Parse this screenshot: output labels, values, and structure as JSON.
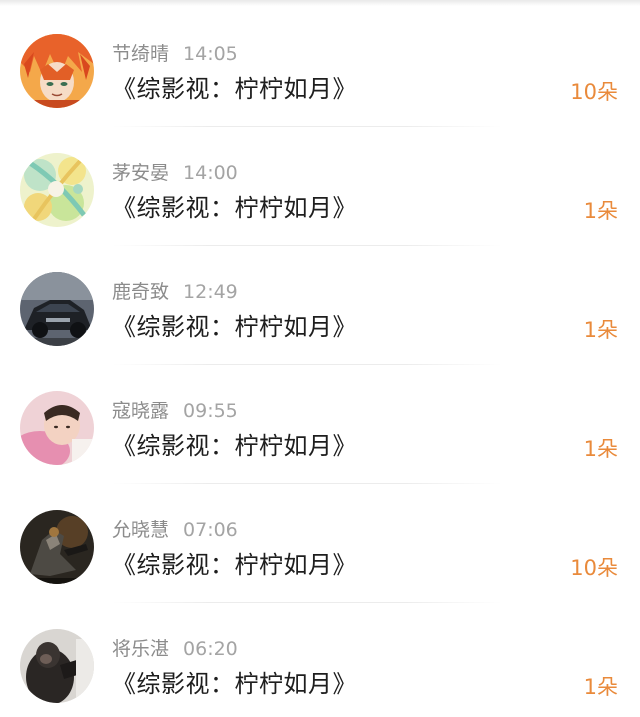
{
  "rows": [
    {
      "name": "节绮晴",
      "time": "14:05",
      "book": "《综影视：柠柠如月》",
      "gift": "10朵"
    },
    {
      "name": "茅安晏",
      "time": "14:00",
      "book": "《综影视：柠柠如月》",
      "gift": "1朵"
    },
    {
      "name": "鹿奇致",
      "time": "12:49",
      "book": "《综影视：柠柠如月》",
      "gift": "1朵"
    },
    {
      "name": "寇晓露",
      "time": "09:55",
      "book": "《综影视：柠柠如月》",
      "gift": "1朵"
    },
    {
      "name": "允晓慧",
      "time": "07:06",
      "book": "《综影视：柠柠如月》",
      "gift": "10朵"
    },
    {
      "name": "将乐湛",
      "time": "06:20",
      "book": "《综影视：柠柠如月》",
      "gift": "1朵"
    }
  ],
  "colors": {
    "accent": "#e98a3b",
    "name": "#8c8c8c",
    "title": "#1e1e1e"
  }
}
